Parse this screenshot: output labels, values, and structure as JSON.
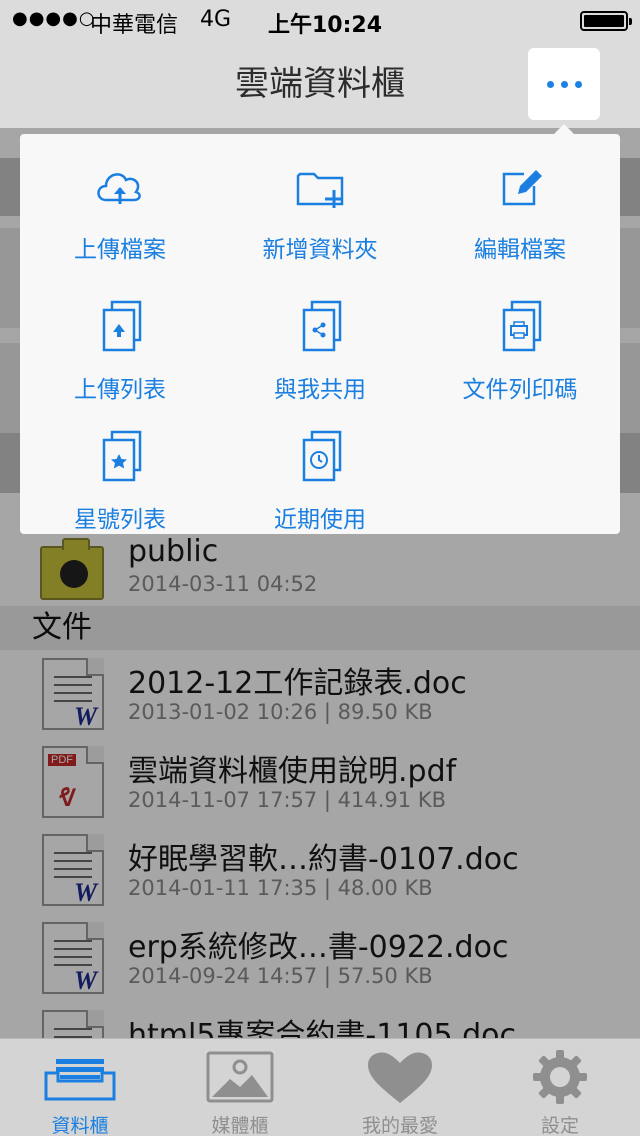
{
  "status_bar": {
    "signal": "●●●●○",
    "carrier": "中華電信",
    "network": "4G",
    "time": "上午10:24"
  },
  "nav": {
    "title": "雲端資料櫃",
    "more_label": "⋯"
  },
  "menu": {
    "items": [
      {
        "label": "上傳檔案",
        "icon": "cloud-upload-icon"
      },
      {
        "label": "新增資料夾",
        "icon": "new-folder-icon"
      },
      {
        "label": "編輯檔案",
        "icon": "edit-file-icon"
      },
      {
        "label": "上傳列表",
        "icon": "upload-list-icon"
      },
      {
        "label": "與我共用",
        "icon": "shared-with-me-icon"
      },
      {
        "label": "文件列印碼",
        "icon": "print-code-icon"
      },
      {
        "label": "星號列表",
        "icon": "starred-list-icon"
      },
      {
        "label": "近期使用",
        "icon": "recent-icon"
      }
    ]
  },
  "folder_row": {
    "name": "public",
    "meta": "2014-03-11 04:52"
  },
  "files_section": {
    "title": "文件",
    "files": [
      {
        "name": "2012-12工作記錄表.doc",
        "meta": "2013-01-02 10:26 | 89.50 KB",
        "type": "doc"
      },
      {
        "name": "雲端資料櫃使用說明.pdf",
        "meta": "2014-11-07 17:57 | 414.91 KB",
        "type": "pdf"
      },
      {
        "name": "好眠學習軟…約書-0107.doc",
        "meta": "2014-01-11 17:35 | 48.00 KB",
        "type": "doc"
      },
      {
        "name": "erp系統修改…書-0922.doc",
        "meta": "2014-09-24 14:57 | 57.50 KB",
        "type": "doc"
      },
      {
        "name": "html5專案合約書-1105.doc",
        "meta": "",
        "type": "doc"
      }
    ]
  },
  "tabs": [
    {
      "label": "資料櫃",
      "icon": "cabinet-icon",
      "active": true
    },
    {
      "label": "媒體櫃",
      "icon": "media-icon",
      "active": false
    },
    {
      "label": "我的最愛",
      "icon": "heart-icon",
      "active": false
    },
    {
      "label": "設定",
      "icon": "gear-icon",
      "active": false
    }
  ],
  "colors": {
    "accent": "#1a7fe0",
    "nav_bg": "#dcdcdc",
    "tab_bg": "#d4d4d4"
  }
}
